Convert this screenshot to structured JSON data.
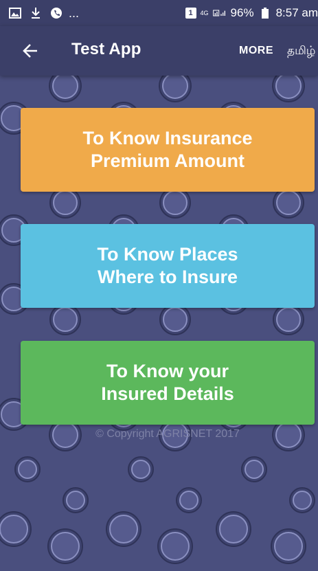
{
  "status_bar": {
    "dots": "...",
    "sim_badge": "1",
    "network_type": "4G",
    "battery": "96%",
    "time": "8:57 am"
  },
  "app_bar": {
    "title": "Test App",
    "more_label": "MORE",
    "language_label": "தமிழ்"
  },
  "buttons": [
    {
      "line1": "To Know Insurance",
      "line2": "Premium Amount",
      "color": "#f0aa4a"
    },
    {
      "line1": "To Know Places",
      "line2": "Where to Insure",
      "color": "#5bc1e1"
    },
    {
      "line1": "To Know your",
      "line2": "Insured Details",
      "color": "#5cb85c"
    }
  ],
  "footer": {
    "copyright": "© Copyright AGRISNET 2017"
  },
  "colors": {
    "background": "#4a4f7e",
    "toolbar": "#3b3f68"
  }
}
